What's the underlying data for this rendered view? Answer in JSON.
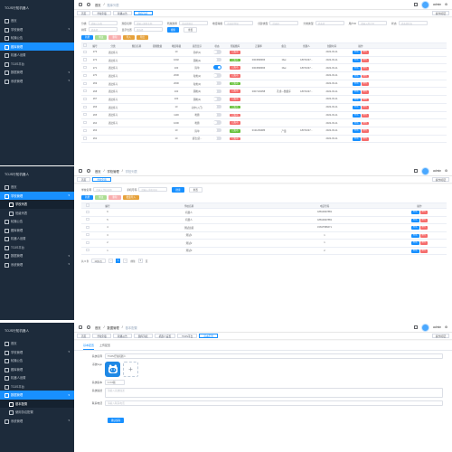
{
  "brand": "TOJS行知机器人",
  "colors": {
    "sidebar": "#1d2b3b",
    "primary": "#1890ff",
    "success": "#67c23a",
    "danger": "#f56c6c"
  },
  "user": "admin",
  "panel1": {
    "sidebar": [
      {
        "label": "首页",
        "icon": "home-icon",
        "caret": ""
      },
      {
        "label": "学校管理",
        "icon": "school-icon",
        "caret": "▾"
      },
      {
        "label": "轮播公告",
        "icon": "notice-icon",
        "caret": ""
      },
      {
        "label": "题库管理",
        "icon": "book-icon",
        "caret": "",
        "active": true
      },
      {
        "label": "机器人设置",
        "icon": "robot-icon",
        "caret": ""
      },
      {
        "label": "TOJS平台",
        "icon": "platform-icon",
        "caret": ""
      },
      {
        "label": "数据管理",
        "icon": "data-icon",
        "caret": "▾"
      },
      {
        "label": "系统管理",
        "icon": "system-icon",
        "caret": "▾"
      }
    ],
    "breadcrumb": [
      "首页",
      "题库列表"
    ],
    "tabs": [
      "首页",
      "学校列表",
      "轮播公告",
      "题库列表"
    ],
    "close_label": "操作按钮",
    "filters": [
      {
        "label": "分类",
        "ph": "请输入分类"
      },
      {
        "label": "题目名称",
        "ph": "请输入题目名称"
      },
      {
        "label": "所属题库",
        "ph": "请选择题库"
      },
      {
        "label": "难度等级",
        "ph": "请选择等级"
      },
      {
        "label": "创建类型",
        "ph": "请选择"
      },
      {
        "label": "分类类型",
        "ph": "请选择"
      },
      {
        "label": "用户ID",
        "ph": "请输入用户ID"
      },
      {
        "label": "状态",
        "ph": "请选择状态"
      },
      {
        "label": "排序",
        "ph": "请选择"
      },
      {
        "label": "显示位置",
        "ph": "请选择"
      }
    ],
    "search": "搜索",
    "reset": "重置",
    "toolbar": [
      "新增",
      "修改",
      "删除",
      "导入",
      "导出"
    ],
    "headers": [
      "",
      "编号",
      "分类",
      "题目名称",
      "答题数量",
      "难度等级",
      "是否显示",
      "状态",
      "所属题库",
      "正确率",
      "备注",
      "创建人",
      "创建时间",
      "操作"
    ],
    "rows": [
      [
        "",
        "273",
        "语法练习",
        "",
        "",
        "10",
        "简单(1)",
        "off",
        "已发布",
        "",
        "",
        "",
        "2022-03-11",
        "修改|删除"
      ],
      [
        "",
        "272",
        "语法练习",
        "",
        "",
        "1002",
        "困难(4)",
        "off",
        "已发布",
        "0004568966",
        "libai",
        "18071037...",
        "2022-03-11",
        "修改|删除"
      ],
      [
        "",
        "271",
        "语法练习",
        "",
        "",
        "100",
        "简单",
        "on",
        "已发布",
        "0004568966",
        "libai",
        "18071037...",
        "2022-03-11",
        "修改|删除"
      ],
      [
        "",
        "270",
        "语法练习",
        "",
        "",
        "2000",
        "较难(2)",
        "off",
        "已发布",
        "",
        "",
        "",
        "2022-03-11",
        "修改|删除"
      ],
      [
        "",
        "269",
        "语法练习",
        "",
        "",
        "2000",
        "较难(3)",
        "off",
        "已发布",
        "",
        "",
        "",
        "2022-03-11",
        "修改|删除"
      ],
      [
        "",
        "268",
        "语法练习",
        "",
        "",
        "100",
        "困难(4)",
        "off",
        "已发布",
        "0007103058",
        "孔雀—数据库",
        "18071037...",
        "2022-03-11",
        "修改|删除"
      ],
      [
        "",
        "267",
        "语法练习",
        "",
        "",
        "100",
        "困难(4)",
        "off",
        "已发布",
        "",
        "",
        "",
        "2022-03-11",
        "修改|删除"
      ],
      [
        "",
        "266",
        "语法练习",
        "",
        "",
        "10",
        "初中(入门)",
        "off",
        "已发布",
        "",
        "",
        "",
        "2022-03-11",
        "修改|删除"
      ],
      [
        "",
        "265",
        "语法练习",
        "",
        "",
        "1100",
        "难题",
        "off",
        "已发布",
        "",
        "",
        "",
        "2022-03-11",
        "修改|删除"
      ],
      [
        "",
        "264",
        "语法练习",
        "",
        "",
        "1000",
        "难题",
        "off",
        "已发布",
        "",
        "",
        "",
        "2022-03-11",
        "修改|删除"
      ],
      [
        "",
        "263",
        "",
        "",
        "",
        "10",
        "简单",
        "off",
        "已发布",
        "0131269986",
        "产量",
        "18071037...",
        "2022-03-11",
        "修改|删除"
      ],
      [
        "",
        "262",
        "",
        "",
        "",
        "10",
        "语法(选...",
        "off",
        "已发布",
        "",
        "",
        "",
        "2022-03-11",
        "修改|删除"
      ]
    ]
  },
  "panel2": {
    "sidebar": [
      {
        "label": "首页",
        "icon": "home-icon",
        "caret": ""
      },
      {
        "label": "学校管理",
        "icon": "school-icon",
        "caret": "▾",
        "active": true
      },
      {
        "label": "学校列表",
        "icon": "list-icon",
        "caret": "",
        "sub": true
      },
      {
        "label": "班级列表",
        "icon": "class-icon",
        "caret": "",
        "subdim": true
      },
      {
        "label": "轮播公告",
        "icon": "notice-icon",
        "caret": ""
      },
      {
        "label": "题库管理",
        "icon": "book-icon",
        "caret": ""
      },
      {
        "label": "机器人设置",
        "icon": "robot-icon",
        "caret": ""
      },
      {
        "label": "TOJS平台",
        "icon": "platform-icon",
        "caret": ""
      },
      {
        "label": "数据管理",
        "icon": "data-icon",
        "caret": "▾"
      },
      {
        "label": "系统管理",
        "icon": "system-icon",
        "caret": "▾"
      }
    ],
    "breadcrumb": [
      "首页",
      "学校管理",
      "学校列表"
    ],
    "tabs": [
      "首页",
      "学校列表"
    ],
    "close_label": "操作按钮",
    "filters": [
      {
        "label": "学校名称",
        "ph": "请输入学校名称"
      },
      {
        "label": "手机号码",
        "ph": "请输入手机号码"
      }
    ],
    "search": "搜索",
    "reset": "重置",
    "toolbar": [
      "新增",
      "修改",
      "删除",
      "批量导入"
    ],
    "headers": [
      "",
      "编号",
      "学校名称",
      "电话号码",
      "操作"
    ],
    "rows": [
      [
        "",
        "6",
        "机器人",
        "18810937883",
        "修改|删除"
      ],
      [
        "",
        "5",
        "机器人",
        "18810937883",
        "修改|删除"
      ],
      [
        "",
        "4",
        "测试班级",
        "15637586671",
        "修改|删除"
      ],
      [
        "",
        "3",
        "测试1",
        "1",
        "修改|删除"
      ],
      [
        "",
        "2",
        "测试2",
        "1",
        "修改|删除"
      ],
      [
        "",
        "1",
        "测试3",
        "2",
        "修改|删除"
      ]
    ],
    "pagination": {
      "total": "共 6 条",
      "size": "10条/页",
      "page": "1",
      "goto": "前往",
      "page_input": "1",
      "page_suffix": "页"
    }
  },
  "panel3": {
    "sidebar": [
      {
        "label": "首页",
        "icon": "home-icon",
        "caret": ""
      },
      {
        "label": "学校管理",
        "icon": "school-icon",
        "caret": "▾"
      },
      {
        "label": "轮播公告",
        "icon": "notice-icon",
        "caret": ""
      },
      {
        "label": "题库管理",
        "icon": "book-icon",
        "caret": ""
      },
      {
        "label": "机器人设置",
        "icon": "robot-icon",
        "caret": ""
      },
      {
        "label": "TOJS平台",
        "icon": "platform-icon",
        "caret": ""
      },
      {
        "label": "数据管理",
        "icon": "data-icon",
        "caret": "▾",
        "active": true
      },
      {
        "label": "基本配置",
        "icon": "config-icon",
        "caret": "",
        "sub": true
      },
      {
        "label": "使用协议配置",
        "icon": "agreement-icon",
        "caret": "",
        "subdim": true
      },
      {
        "label": "系统管理",
        "icon": "system-icon",
        "caret": "▾"
      }
    ],
    "breadcrumb": [
      "首页",
      "数据管理",
      "基本配置"
    ],
    "tabs": [
      "首页",
      "学校列表",
      "轮播公告",
      "题库列表",
      "机器人设置",
      "TOJS平台",
      "基本配置"
    ],
    "close_label": "操作按钮",
    "form_tabs": [
      "基本配置",
      "上传配置"
    ],
    "fields": {
      "name_label": "系统名称",
      "name_value": "TOJS行知机器人",
      "logo_label": "系统logo",
      "version_label": "系统版本",
      "version_value": "1.0.0版",
      "desc_label": "系统描述",
      "desc_ph": "请输入系统描述",
      "contact_label": "联系电话",
      "contact_ph": "请输入联系电话",
      "submit": "确认保存"
    }
  }
}
